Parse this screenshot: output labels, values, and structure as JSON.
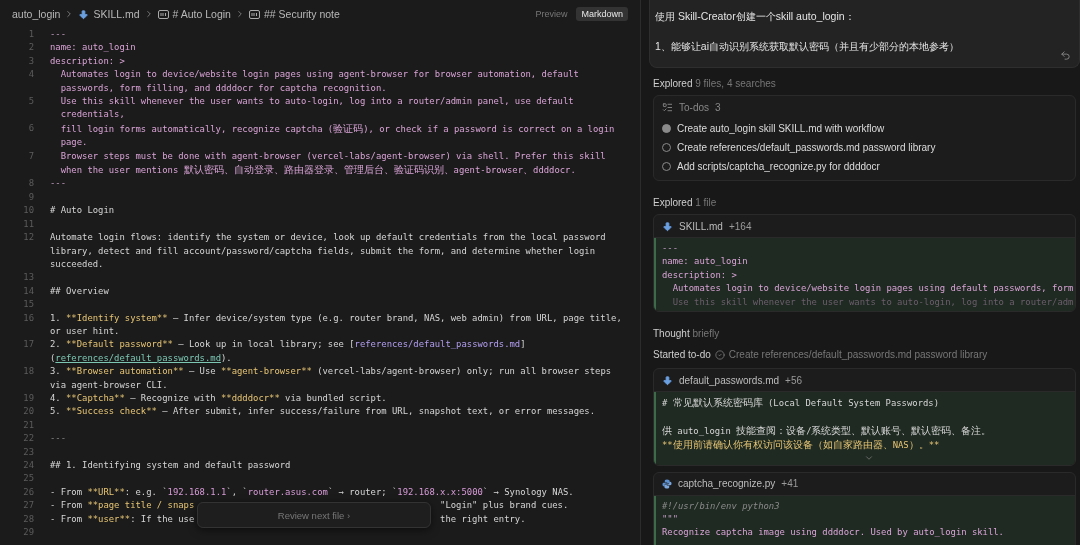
{
  "breadcrumb": [
    {
      "kind": "folder",
      "label": "auto_login"
    },
    {
      "kind": "file",
      "label": "SKILL.md"
    },
    {
      "kind": "heading",
      "label": "# Auto Login"
    },
    {
      "kind": "heading",
      "label": "## Security note"
    }
  ],
  "view_tabs": [
    {
      "label": "Preview",
      "selected": false
    },
    {
      "label": "Markdown",
      "selected": true
    }
  ],
  "editor_lines": [
    {
      "number": "1",
      "segments": [
        {
          "kind": "punct",
          "text": "---"
        }
      ]
    },
    {
      "number": "2",
      "segments": [
        {
          "kind": "key",
          "text": "name: auto_login"
        }
      ]
    },
    {
      "number": "3",
      "segments": [
        {
          "kind": "key",
          "text": "description: >"
        }
      ]
    },
    {
      "number": "4",
      "indent": true,
      "segments": [
        {
          "kind": "string",
          "text": "Automates login to device/website login pages using agent-browser for browser automation, default passwords, form filling, and ddddocr for captcha recognition."
        }
      ]
    },
    {
      "number": "5",
      "indent": true,
      "segments": [
        {
          "kind": "string",
          "text": "Use this skill whenever the user wants to auto-login, log into a router/admin panel, use default credentials,"
        }
      ]
    },
    {
      "number": "6",
      "indent": true,
      "segments": [
        {
          "kind": "string",
          "text": "fill login forms automatically, recognize captcha (验证码), or check if a password is correct on a login page."
        }
      ]
    },
    {
      "number": "7",
      "indent": true,
      "segments": [
        {
          "kind": "string",
          "text": "Browser steps must be done with agent-browser (vercel-labs/agent-browser) via shell. Prefer this skill when the user mentions 默认密码、自动登录、路由器登录、管理后台、验证码识别、agent-browser、ddddocr."
        }
      ]
    },
    {
      "number": "8",
      "segments": [
        {
          "kind": "punct",
          "text": "---"
        }
      ]
    },
    {
      "number": "9"
    },
    {
      "number": "10",
      "segments": [
        {
          "kind": "plain",
          "text": "# Auto Login"
        }
      ]
    },
    {
      "number": "11"
    },
    {
      "number": "12",
      "segments": [
        {
          "kind": "plain",
          "text": "Automate login flows: identify the system or device, look up default credentials from the local password library, detect and fill account/password/captcha fields, submit the form, and determine whether login succeeded."
        }
      ]
    },
    {
      "number": "13"
    },
    {
      "number": "14",
      "segments": [
        {
          "kind": "plain",
          "text": "## Overview"
        }
      ]
    },
    {
      "number": "15"
    },
    {
      "number": "16",
      "segments": [
        {
          "kind": "plain",
          "text": "1. "
        },
        {
          "kind": "bold",
          "text": "**Identify system**"
        },
        {
          "kind": "plain",
          "text": " — Infer device/system type (e.g. router brand, NAS, web admin) from URL, page title, or user hint."
        }
      ]
    },
    {
      "number": "17",
      "segments": [
        {
          "kind": "plain",
          "text": "2. "
        },
        {
          "kind": "bold",
          "text": "**Default password**"
        },
        {
          "kind": "plain",
          "text": " — Look up in local library; see ["
        },
        {
          "kind": "link",
          "text": "references/default_passwords.md"
        },
        {
          "kind": "plain",
          "text": "]("
        },
        {
          "kind": "url",
          "text": "references/default_passwords.md"
        },
        {
          "kind": "plain",
          "text": ")."
        }
      ]
    },
    {
      "number": "18",
      "segments": [
        {
          "kind": "plain",
          "text": "3. "
        },
        {
          "kind": "bold",
          "text": "**Browser automation**"
        },
        {
          "kind": "plain",
          "text": " — Use "
        },
        {
          "kind": "bold",
          "text": "**agent-browser**"
        },
        {
          "kind": "plain",
          "text": " (vercel-labs/agent-browser) only; run all browser steps via agent-browser CLI."
        }
      ]
    },
    {
      "number": "19",
      "segments": [
        {
          "kind": "plain",
          "text": "4. "
        },
        {
          "kind": "bold",
          "text": "**Captcha**"
        },
        {
          "kind": "plain",
          "text": " — Recognize with "
        },
        {
          "kind": "bold",
          "text": "**ddddocr**"
        },
        {
          "kind": "plain",
          "text": " via bundled script."
        }
      ]
    },
    {
      "number": "20",
      "segments": [
        {
          "kind": "plain",
          "text": "5. "
        },
        {
          "kind": "bold",
          "text": "**Success check**"
        },
        {
          "kind": "plain",
          "text": " — After submit, infer success/failure from URL, snapshot text, or error messages."
        }
      ]
    },
    {
      "number": "21"
    },
    {
      "number": "22",
      "segments": [
        {
          "kind": "rule",
          "text": "---"
        }
      ]
    },
    {
      "number": "23"
    },
    {
      "number": "24",
      "segments": [
        {
          "kind": "plain",
          "text": "## 1. Identifying system and default password"
        }
      ]
    },
    {
      "number": "25"
    },
    {
      "number": "26",
      "segments": [
        {
          "kind": "plain",
          "text": "- From "
        },
        {
          "kind": "bold",
          "text": "**URL**"
        },
        {
          "kind": "plain",
          "text": ": e.g. `"
        },
        {
          "kind": "code",
          "text": "192.168.1.1"
        },
        {
          "kind": "plain",
          "text": "`, `"
        },
        {
          "kind": "code",
          "text": "router.asus.com"
        },
        {
          "kind": "plain",
          "text": "` → router; `"
        },
        {
          "kind": "code",
          "text": "192.168.x.x:5000"
        },
        {
          "kind": "plain",
          "text": "` → Synology NAS."
        }
      ]
    },
    {
      "number": "27",
      "segments": [
        {
          "kind": "plain",
          "text": "- From "
        },
        {
          "kind": "bold",
          "text": "**page title / snaps"
        },
        {
          "kind": "gap"
        },
        {
          "kind": "plain",
          "text": "\"Login\" plus brand cues."
        }
      ]
    },
    {
      "number": "28",
      "segments": [
        {
          "kind": "plain",
          "text": "- From "
        },
        {
          "kind": "bold",
          "text": "**user**"
        },
        {
          "kind": "plain",
          "text": ": If the use"
        },
        {
          "kind": "gap"
        },
        {
          "kind": "plain",
          "text": "the right entry."
        }
      ]
    },
    {
      "number": "29"
    }
  ],
  "review_button": {
    "label": "Review next file ›"
  },
  "prompt": {
    "lines": [
      "使用 Skill-Creator创建一个skill auto_login：",
      "1、能够让ai自动识别系统获取默认密码（并且有少部分的本地参考）"
    ]
  },
  "activity": [
    {
      "kind": "status",
      "label": "Explored",
      "detail": "9 files, 4 searches"
    },
    {
      "kind": "todos",
      "title": "To-dos",
      "count": "3",
      "items": [
        {
          "text": "Create auto_login skill SKILL.md with workflow",
          "active": true
        },
        {
          "text": "Create references/default_passwords.md password library",
          "active": false
        },
        {
          "text": "Add scripts/captcha_recognize.py for ddddocr",
          "active": false
        }
      ]
    },
    {
      "kind": "status",
      "label": "Explored",
      "detail": "1 file"
    },
    {
      "kind": "markdown",
      "name": "SKILL.md",
      "added": "+164",
      "lines": [
        {
          "kind": "punct",
          "text": "---"
        },
        {
          "kind": "key",
          "text": "name: auto_login"
        },
        {
          "kind": "key",
          "text": "description: >"
        },
        {
          "kind": "string",
          "text": "  Automates login to device/website login pages using default passwords, form"
        },
        {
          "kind": "faded",
          "text": "  Use this skill whenever the user wants to auto-login, log into a router/adm"
        }
      ]
    },
    {
      "kind": "status",
      "label": "Thought",
      "detail": "briefly"
    },
    {
      "kind": "started",
      "label": "Started to-do",
      "detail": "Create references/default_passwords.md password library"
    },
    {
      "kind": "markdown",
      "name": "default_passwords.md",
      "added": "+56",
      "show_more": true,
      "lines": [
        {
          "kind": "plain",
          "text": "# 常见默认系统密码库 (Local Default System Passwords)"
        },
        {
          "kind": "blank"
        },
        {
          "kind": "plain",
          "text": "供 auto_login 技能查阅：设备/系统类型、默认账号、默认密码、备注。"
        },
        {
          "kind": "bold",
          "open": "**",
          "text": "使用前请确认你有权访问该设备（如自家路由器、NAS）。",
          "close": "**"
        }
      ]
    },
    {
      "kind": "python",
      "name": "captcha_recognize.py",
      "added": "+41",
      "lines": [
        {
          "kind": "comment",
          "text": "#!/usr/bin/env python3"
        },
        {
          "kind": "punct",
          "text": "\"\"\""
        },
        {
          "kind": "string",
          "text": "Recognize captcha image using ddddocr. Used by auto_login skill."
        },
        {
          "kind": "blank"
        }
      ]
    }
  ]
}
